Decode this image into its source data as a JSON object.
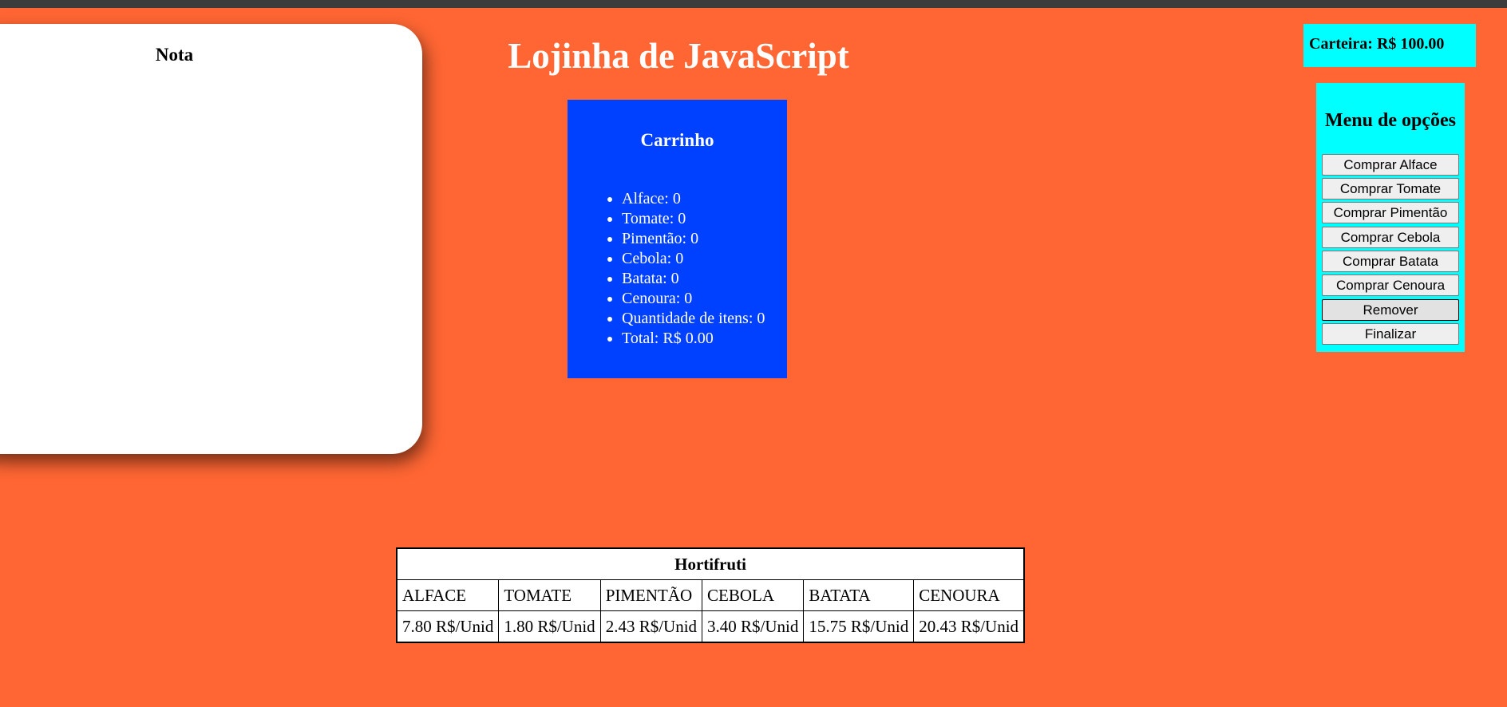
{
  "page": {
    "title": "Lojinha de JavaScript"
  },
  "nota": {
    "title": "Nota"
  },
  "carrinho": {
    "title": "Carrinho",
    "items": [
      "Alface: 0",
      "Tomate: 0",
      "Pimentão: 0",
      "Cebola: 0",
      "Batata: 0",
      "Cenoura: 0",
      "Quantidade de itens: 0",
      "Total: R$ 0.00"
    ]
  },
  "carteira": {
    "label": "Carteira: R$ 100.00"
  },
  "menu": {
    "title": "Menu de opções",
    "buttons": [
      "Comprar Alface",
      "Comprar Tomate",
      "Comprar Pimentão",
      "Comprar Cebola",
      "Comprar Batata",
      "Comprar Cenoura",
      "Remover",
      "Finalizar"
    ]
  },
  "hortifruti": {
    "caption": "Hortifruti",
    "headers": [
      "ALFACE",
      "TOMATE",
      "PIMENTÃO",
      "CEBOLA",
      "BATATA",
      "CENOURA"
    ],
    "prices": [
      "7.80 R$/Unid",
      "1.80 R$/Unid",
      "2.43 R$/Unid",
      "3.40 R$/Unid",
      "15.75 R$/Unid",
      "20.43 R$/Unid"
    ]
  },
  "colors": {
    "background": "#ff6633",
    "carrinho": "#0040ff",
    "menu": "#00ffff",
    "topbar": "#3c3c3c"
  }
}
